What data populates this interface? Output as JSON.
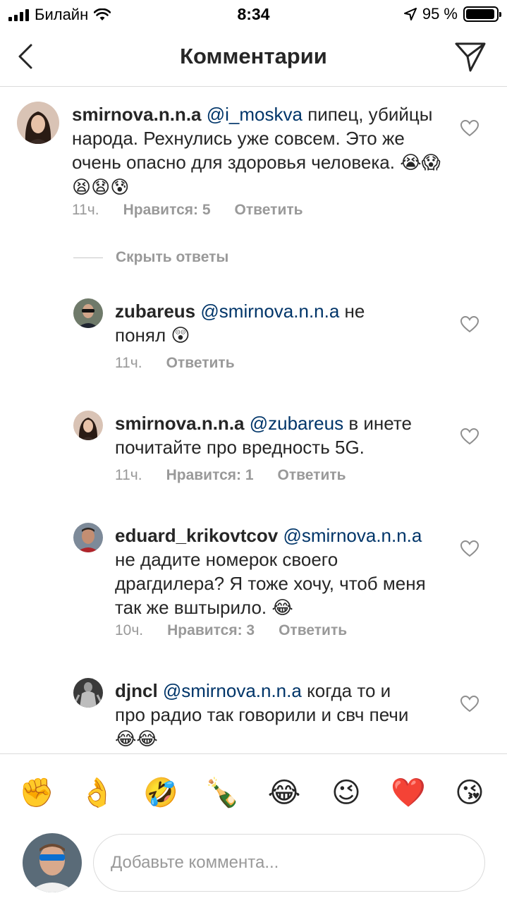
{
  "status_bar": {
    "carrier": "Билайн",
    "time": "8:34",
    "battery": "95 %",
    "battery_level": 0.95
  },
  "header": {
    "title": "Комментарии"
  },
  "comments": [
    {
      "username": "smirnova.n.n.a",
      "mention": "@i_moskva",
      "text": "пипец, убийцы народа. Рехнулись уже совсем. Это же очень опасно для здоровья человека.",
      "emojis": "😭😱😫😧😰",
      "time": "11ч.",
      "likes": "Нравится: 5",
      "reply": "Ответить"
    }
  ],
  "hide_replies_label": "Скрыть ответы",
  "replies": [
    {
      "username": "zubareus",
      "mention": "@smirnova.n.n.a",
      "text": "не понял",
      "emojis": "😲",
      "time": "11ч.",
      "likes": "",
      "reply": "Ответить"
    },
    {
      "username": "smirnova.n.n.a",
      "mention": "@zubareus",
      "text": "в инете почитайте про вредность 5G.",
      "emojis": "",
      "time": "11ч.",
      "likes": "Нравится: 1",
      "reply": "Ответить"
    },
    {
      "username": "eduard_krikovtcov",
      "mention": "@smirnova.n.n.a",
      "text": "не дадите номерок своего драгдилера? Я тоже хочу, чтоб меня так же вштырило.",
      "emojis": "😂",
      "time": "10ч.",
      "likes": "Нравится: 3",
      "reply": "Ответить"
    },
    {
      "username": "djncl",
      "mention": "@smirnova.n.n.a",
      "text": "когда то и про радио так говорили и свч печи",
      "emojis": "😂😂",
      "time": "",
      "likes": "",
      "reply": ""
    }
  ],
  "emoji_bar": [
    "✊",
    "👌",
    "🤣",
    "🍾",
    "😂",
    "😉",
    "❤️",
    "😘"
  ],
  "input": {
    "placeholder": "Добавьте коммента..."
  }
}
